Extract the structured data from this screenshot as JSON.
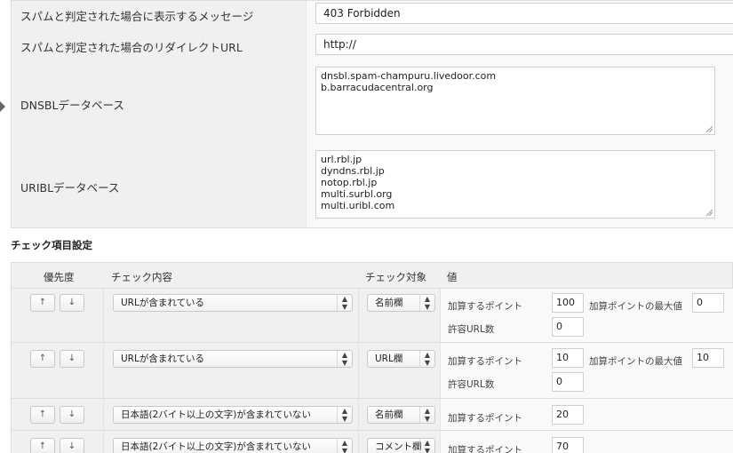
{
  "form": {
    "spam_message_label": "スパムと判定された場合に表示するメッセージ",
    "spam_message_value": "403 Forbidden",
    "redirect_label": "スパムと判定された場合のリダイレクトURL",
    "redirect_value": "http://",
    "dnsbl_label": "DNSBLデータベース",
    "dnsbl_lines": [
      "dnsbl.spam-champuru.livedoor.com",
      "b.barracudacentral.org"
    ],
    "uribl_label": "URIBLデータベース",
    "uribl_lines": [
      "url.rbl.jp",
      "dyndns.rbl.jp",
      "notop.rbl.jp",
      "multi.surbl.org",
      "multi.uribl.com"
    ]
  },
  "check_section": {
    "title": "チェック項目設定",
    "headers": {
      "priority": "優先度",
      "content": "チェック内容",
      "target": "チェック対象",
      "value": "値"
    },
    "up_arrow": "↑",
    "down_arrow": "↓",
    "rows": [
      {
        "content": "URLが含まれている",
        "target": "名前欄",
        "add_points_label": "加算するポイント",
        "add_points": "100",
        "max_points_label": "加算ポイントの最大値",
        "max_points": "0",
        "allowed_url_label": "許容URL数",
        "allowed_url": "0"
      },
      {
        "content": "URLが含まれている",
        "target": "URL欄",
        "add_points_label": "加算するポイント",
        "add_points": "10",
        "max_points_label": "加算ポイントの最大値",
        "max_points": "10",
        "allowed_url_label": "許容URL数",
        "allowed_url": "0"
      },
      {
        "content": "日本語(2バイト以上の文字)が含まれていない",
        "target": "名前欄",
        "add_points_label": "加算するポイント",
        "add_points": "20"
      },
      {
        "content": "日本語(2バイト以上の文字)が含まれていない",
        "target": "コメント欄",
        "add_points_label": "加算するポイント",
        "add_points": "70"
      }
    ]
  }
}
